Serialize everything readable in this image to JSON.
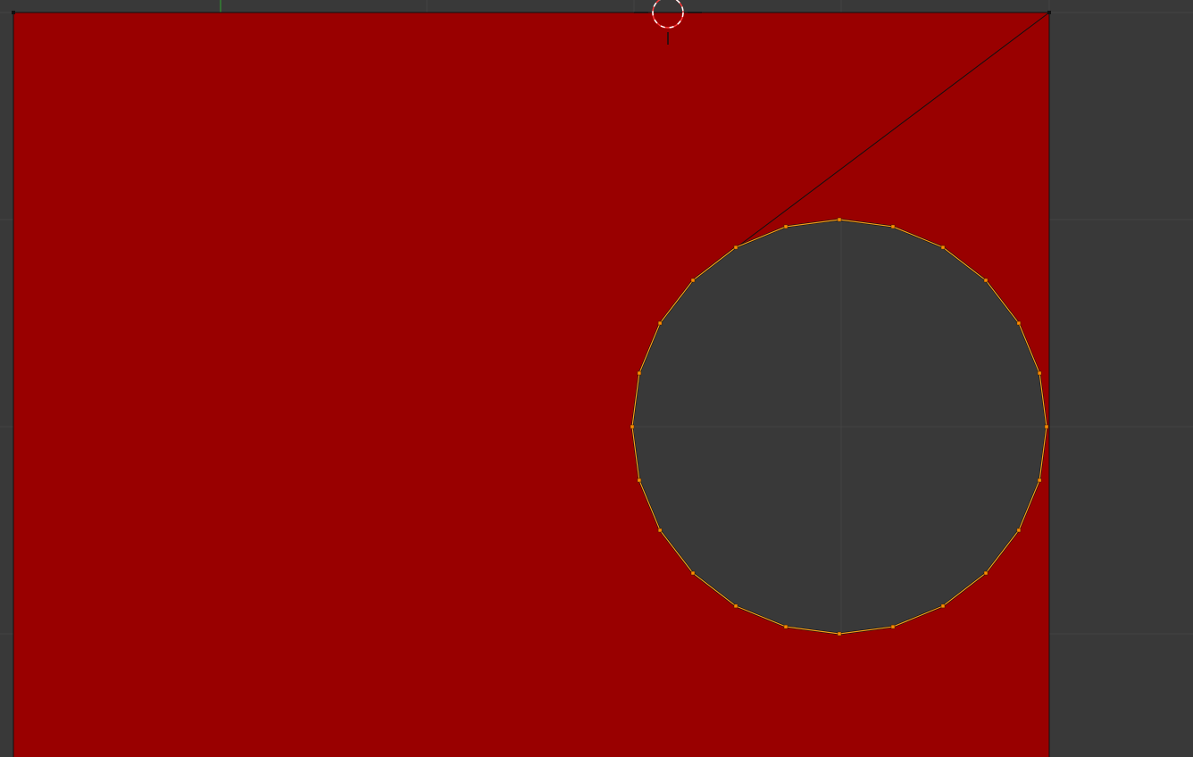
{
  "viewport": {
    "name": "3d-viewport",
    "background_color": "#393939",
    "grid_line_color": "#444444",
    "x_axis_color": "#2fa52f"
  },
  "mesh": {
    "face_color": "#990000",
    "edge_color": "#111111",
    "selected_edge_color": "#f59d1a",
    "vertex_color": "#111111",
    "selected_vertex_color": "#ff8c00",
    "hole_vertex_count": 24,
    "selected": "circle-loop"
  },
  "cursor": {
    "name": "3d-cursor",
    "ring_colors": [
      "#ff3b3b",
      "#ffffff"
    ],
    "crosshair_color": "#111111"
  }
}
